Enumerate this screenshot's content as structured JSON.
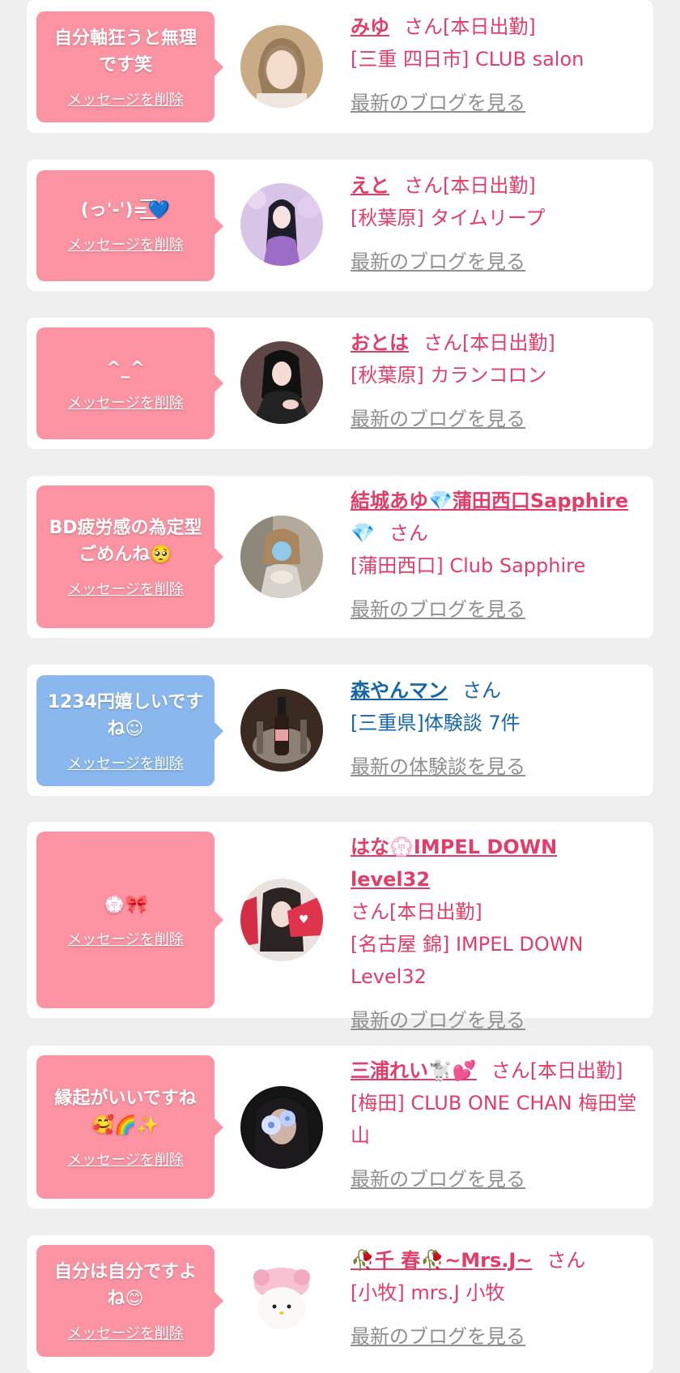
{
  "delete_label": "メッセージを削除",
  "san_label": "さん",
  "items": [
    {
      "message": "自分軸狂うと無理です笑",
      "name": "みゆ",
      "suffix": "さん[本日出勤]",
      "shop": "[三重 四日市] CLUB salon",
      "link": "最新のブログを見る"
    },
    {
      "message": "(っ'-')=͟͟͞͞💙",
      "name": "えと",
      "suffix": "さん[本日出勤]",
      "shop": "[秋葉原] タイムリープ",
      "link": "最新のブログを見る"
    },
    {
      "message": "^_^",
      "name": "おとは",
      "suffix": "さん[本日出勤]",
      "shop": "[秋葉原] カランコロン",
      "link": "最新のブログを見る"
    },
    {
      "message": "BD疲労感の為定型ごめんね🥺",
      "name": "結城あゆ💎蒲田西口Sapphire",
      "name_tail": "💎",
      "suffix": "さん",
      "shop": "[蒲田西口] Club Sapphire",
      "link": "最新のブログを見る"
    },
    {
      "message": "1234円嬉しいですね☺",
      "name": "森やんマン",
      "suffix": "さん",
      "shop": "[三重県]体験談 7件",
      "link": "最新の体験談を見る"
    },
    {
      "message": "💮🎀",
      "name": "はな💮IMPEL DOWN level32",
      "suffix": "さん[本日出勤]",
      "shop": "[名古屋 錦] IMPEL DOWN Level32",
      "link": "最新のブログを見る"
    },
    {
      "message": "縁起がいいですね🥰🌈✨",
      "name": "三浦れい🐩💕",
      "suffix": "さん[本日出勤]",
      "shop": "[梅田] CLUB ONE CHAN 梅田堂山",
      "link": "最新のブログを見る"
    },
    {
      "message": "自分は自分ですよね😊",
      "name": "🥀千 春🥀~Mrs.J~",
      "suffix": "さん",
      "shop": "[小牧] mrs.J 小牧",
      "link": "最新のブログを見る"
    }
  ]
}
